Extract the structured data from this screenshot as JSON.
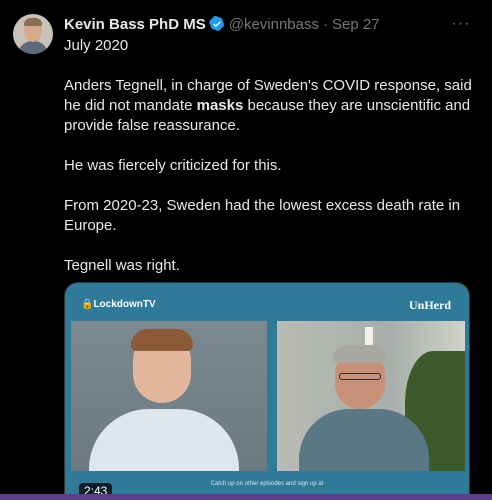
{
  "tweet": {
    "author_name": "Kevin Bass PhD MS",
    "handle": "@kevinnbass",
    "separator": "·",
    "date": "Sep 27",
    "more_icon": "more-horizontal-icon",
    "paragraphs": [
      "July 2020",
      "",
      "Anders Tegnell, in charge of Sweden's COVID response, said he did not mandate ",
      "masks",
      " because they are unscientific and provide false reassurance.",
      "He was fiercely criticized for this.",
      "From 2020-23, Sweden had the lowest excess death rate in Europe.",
      "Tegnell was right."
    ]
  },
  "media": {
    "brand_left": "🔒LockdownTV",
    "brand_right": "UnHerd",
    "caption": "Catch up on other episodes and sign up at",
    "duration": "2:43"
  },
  "colors": {
    "background": "#000000",
    "text": "#e7e9ea",
    "muted": "#71767b",
    "verified": "#1d9bf0",
    "media_bg": "#2e7a98"
  }
}
